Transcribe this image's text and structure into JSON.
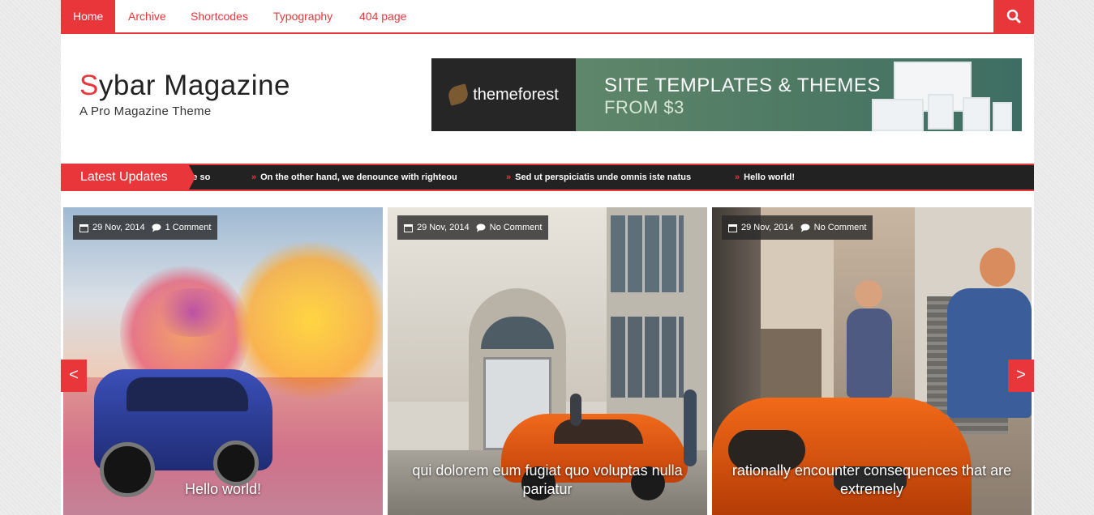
{
  "nav": {
    "items": [
      {
        "label": "Home",
        "active": true
      },
      {
        "label": "Archive",
        "active": false
      },
      {
        "label": "Shortcodes",
        "active": false
      },
      {
        "label": "Typography",
        "active": false
      },
      {
        "label": "404 page",
        "active": false
      }
    ],
    "search_icon": "search-icon"
  },
  "header": {
    "logo_first": "S",
    "logo_rest": "ybar Magazine",
    "tagline": "A Pro Magazine Theme"
  },
  "banner": {
    "brand": "themeforest",
    "line1": "SITE TEMPLATES & THEMES",
    "line2": "FROM $3"
  },
  "ticker": {
    "label": "Latest Updates",
    "items": [
      "re so",
      "On the other hand, we denounce with righteou",
      "Sed ut perspiciatis unde omnis iste natus",
      "Hello world!"
    ]
  },
  "slider": {
    "prev": "<",
    "next": ">",
    "slides": [
      {
        "date": "29 Nov, 2014",
        "comments": "1 Comment",
        "title": "Hello world!"
      },
      {
        "date": "29 Nov, 2014",
        "comments": "No Comment",
        "title": "qui dolorem eum fugiat quo voluptas nulla pariatur"
      },
      {
        "date": "29 Nov, 2014",
        "comments": "No Comment",
        "title": "rationally encounter consequences that are extremely"
      }
    ]
  },
  "colors": {
    "accent": "#e8363b",
    "ticker_bg": "#222222"
  }
}
